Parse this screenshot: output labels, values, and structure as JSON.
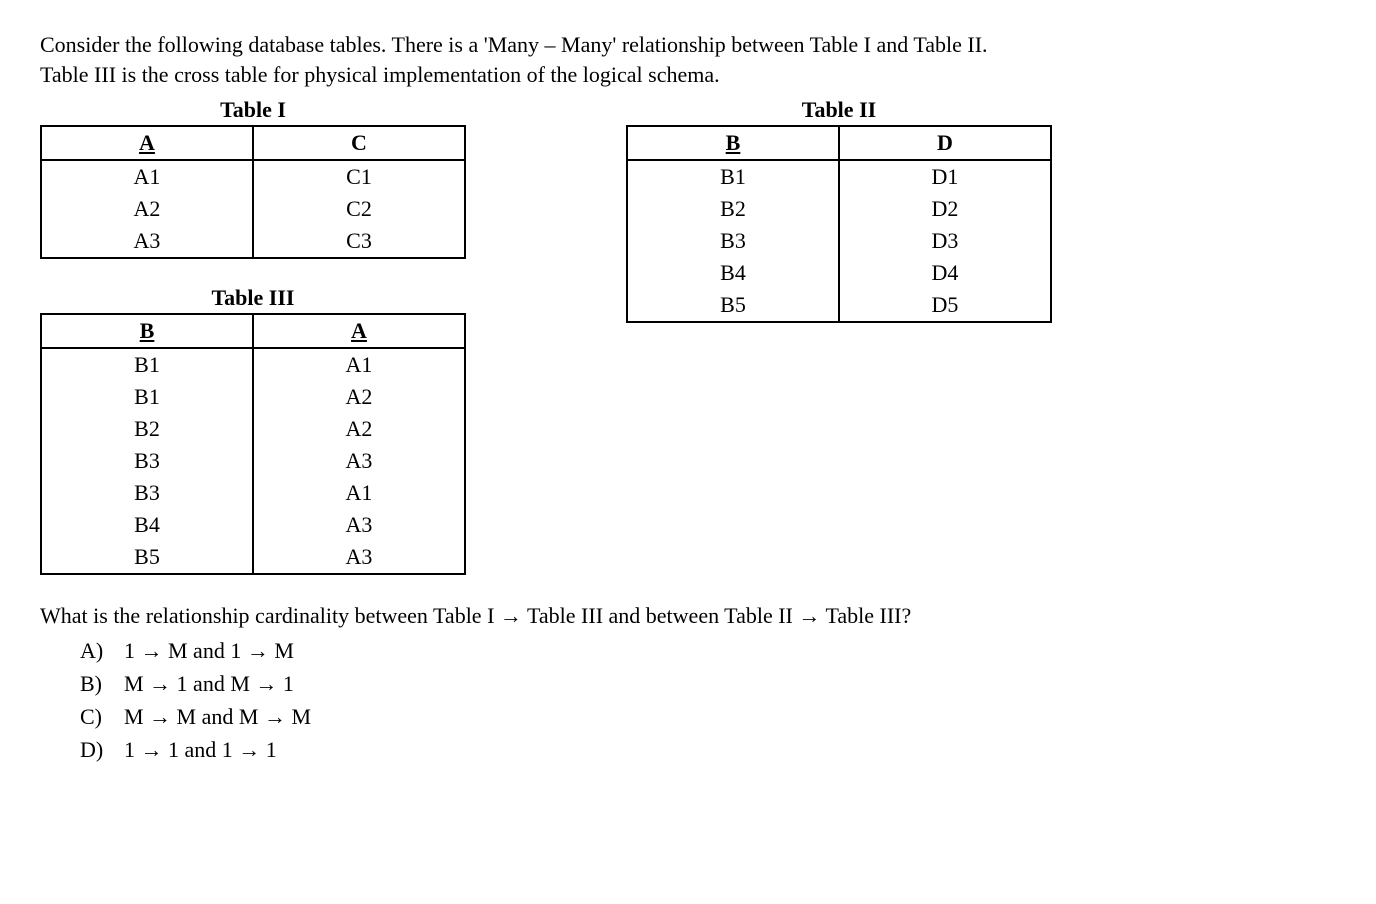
{
  "intro": {
    "line1": "Consider the following database tables. There is a 'Many – Many' relationship between Table I and Table II.",
    "line2": "Table III is the cross table for physical implementation of the logical schema."
  },
  "table1": {
    "title": "Table I",
    "headers": {
      "col1": "A",
      "col2": "C"
    },
    "rows": [
      {
        "c1": "A1",
        "c2": "C1"
      },
      {
        "c1": "A2",
        "c2": "C2"
      },
      {
        "c1": "A3",
        "c2": "C3"
      }
    ]
  },
  "table2": {
    "title": "Table II",
    "headers": {
      "col1": "B",
      "col2": "D"
    },
    "rows": [
      {
        "c1": "B1",
        "c2": "D1"
      },
      {
        "c1": "B2",
        "c2": "D2"
      },
      {
        "c1": "B3",
        "c2": "D3"
      },
      {
        "c1": "B4",
        "c2": "D4"
      },
      {
        "c1": "B5",
        "c2": "D5"
      }
    ]
  },
  "table3": {
    "title": "Table III",
    "headers": {
      "col1": "B",
      "col2": "A"
    },
    "rows": [
      {
        "c1": "B1",
        "c2": "A1"
      },
      {
        "c1": "B1",
        "c2": "A2"
      },
      {
        "c1": "B2",
        "c2": "A2"
      },
      {
        "c1": "B3",
        "c2": "A3"
      },
      {
        "c1": "B3",
        "c2": "A1"
      },
      {
        "c1": "B4",
        "c2": "A3"
      },
      {
        "c1": "B5",
        "c2": "A3"
      }
    ]
  },
  "question": "What is the relationship cardinality between Table I → Table III and between Table II → Table III?",
  "options": [
    {
      "letter": "A)",
      "text": "1 → M and 1 → M"
    },
    {
      "letter": "B)",
      "text": "M → 1 and M → 1"
    },
    {
      "letter": "C)",
      "text": "M → M and M → M"
    },
    {
      "letter": "D)",
      "text": "1 → 1 and 1 → 1"
    }
  ]
}
